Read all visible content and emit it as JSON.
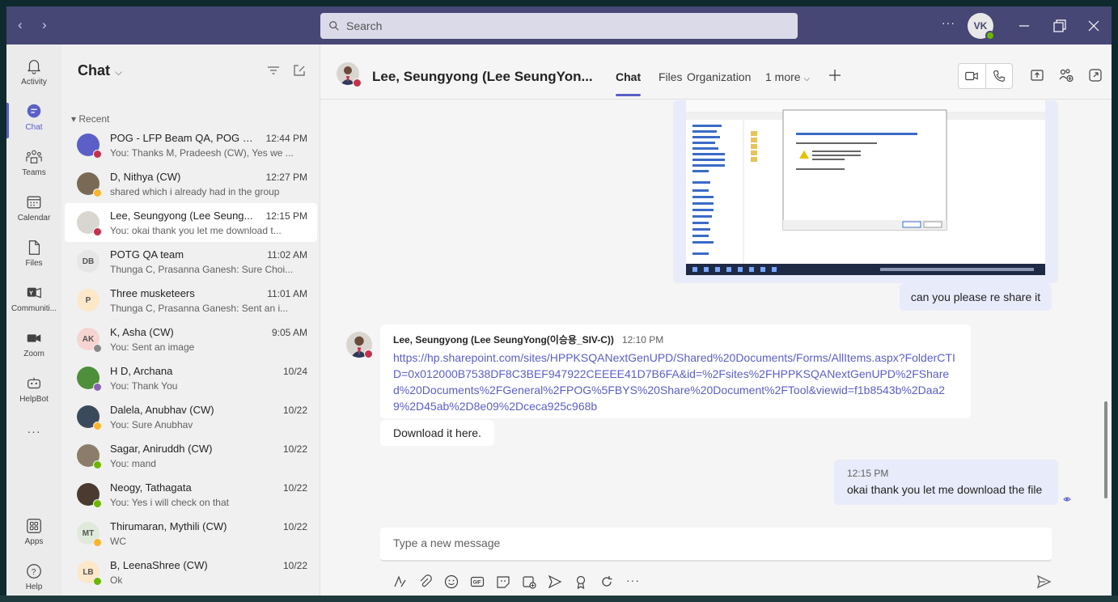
{
  "titlebar": {
    "back_glyph": "‹",
    "forward_glyph": "›",
    "search_placeholder": "Search",
    "more_glyph": "···",
    "user_initials": "VK"
  },
  "rail": {
    "items": [
      {
        "label": "Activity",
        "icon": "bell-icon"
      },
      {
        "label": "Chat",
        "icon": "chat-icon"
      },
      {
        "label": "Teams",
        "icon": "teams-icon"
      },
      {
        "label": "Calendar",
        "icon": "calendar-icon"
      },
      {
        "label": "Files",
        "icon": "file-icon"
      },
      {
        "label": "Communiti...",
        "icon": "communities-icon"
      },
      {
        "label": "Zoom",
        "icon": "video-icon"
      },
      {
        "label": "HelpBot",
        "icon": "bot-icon"
      },
      {
        "label": "···",
        "icon": "more-icon"
      },
      {
        "label": "Apps",
        "icon": "apps-icon"
      },
      {
        "label": "Help",
        "icon": "help-icon"
      }
    ]
  },
  "chatlist": {
    "title": "Chat",
    "section": "Recent",
    "items": [
      {
        "name": "POG - LFP Beam QA, POG La...",
        "time": "12:44 PM",
        "preview": "You: Thanks M, Pradeesh (CW), Yes we ...",
        "initials": "",
        "avatar_color": "#5b5fc7"
      },
      {
        "name": "D, Nithya (CW)",
        "time": "12:27 PM",
        "preview": "shared which i already had in the group",
        "initials": "",
        "avatar_color": "#7a6a55"
      },
      {
        "name": "Lee, Seungyong (Lee Seung...",
        "time": "12:15 PM",
        "preview": "You: okai thank you let me download t...",
        "initials": "",
        "avatar_color": "#d9d6cf"
      },
      {
        "name": "POTG QA team",
        "time": "11:02 AM",
        "preview": "Thunga C, Prasanna Ganesh: Sure Choi...",
        "initials": "DB",
        "avatar_color": "#e6e6e6"
      },
      {
        "name": "Three musketeers",
        "time": "11:01 AM",
        "preview": "Thunga C, Prasanna Ganesh: Sent an i...",
        "initials": "P",
        "avatar_color": "#fde7c9"
      },
      {
        "name": "K, Asha (CW)",
        "time": "9:05 AM",
        "preview": "You: Sent an image",
        "initials": "AK",
        "avatar_color": "#f6d4d1"
      },
      {
        "name": "H D, Archana",
        "time": "10/24",
        "preview": "You: Thank You",
        "initials": "",
        "avatar_color": "#4e8f3a"
      },
      {
        "name": "Dalela, Anubhav (CW)",
        "time": "10/22",
        "preview": "You: Sure Anubhav",
        "initials": "",
        "avatar_color": "#3b4a5a"
      },
      {
        "name": "Sagar, Aniruddh (CW)",
        "time": "10/22",
        "preview": "You: mand",
        "initials": "",
        "avatar_color": "#8c7d6a"
      },
      {
        "name": "Neogy, Tathagata",
        "time": "10/22",
        "preview": "You: Yes i will check on that",
        "initials": "",
        "avatar_color": "#4a3a30"
      },
      {
        "name": "Thirumaran, Mythili (CW)",
        "time": "10/22",
        "preview": "WC",
        "initials": "MT",
        "avatar_color": "#dfeadb"
      },
      {
        "name": "B, LeenaShree (CW)",
        "time": "10/22",
        "preview": "Ok",
        "initials": "LB",
        "avatar_color": "#fde7c9"
      }
    ]
  },
  "main": {
    "contact_name": "Lee, Seungyong (Lee SeungYon...",
    "tabs": [
      "Chat",
      "Files",
      "Organization",
      "1 more"
    ],
    "messages": {
      "my_reply": "can you please re share it",
      "their_sender": "Lee, Seungyong (Lee SeungYong(이승용_SIV-C))",
      "their_time": "12:10 PM",
      "their_link": "https://hp.sharepoint.com/sites/HPPKSQANextGenUPD/Shared%20Documents/Forms/AllItems.aspx?FolderCTID=0x012000B7538DF8C3BEF947922CEEEE41D7B6FA&id=%2Fsites%2FHPPKSQANextGenUPD%2FShared%20Documents%2FGeneral%2FPOG%5FBYS%20Share%20Document%2FTool&viewid=f1b8543b%2Daa29%2D45ab%2D8e09%2Dceca925c968b",
      "their_followup": "Download it here.",
      "my_time": "12:15 PM",
      "my_last": "okai thank you let me download the file"
    },
    "compose_placeholder": "Type a new message"
  },
  "colors": {
    "titlebar": "#464775",
    "accent": "#5b5fc7",
    "my_bubble": "#e8ebfa",
    "busy": "#c4314b",
    "available": "#6bb700",
    "away": "#f8b42c"
  }
}
